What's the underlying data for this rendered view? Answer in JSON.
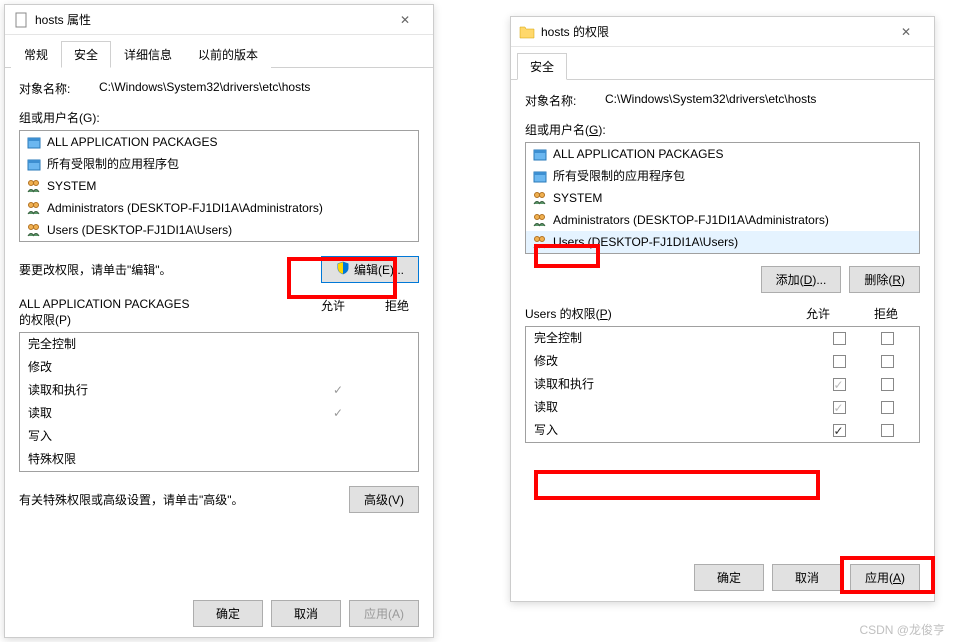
{
  "left": {
    "title": "hosts 属性",
    "tabs": [
      "常规",
      "安全",
      "详细信息",
      "以前的版本"
    ],
    "active_tab_index": 1,
    "object_label": "对象名称:",
    "object_value": "C:\\Windows\\System32\\drivers\\etc\\hosts",
    "group_label": "组或用户名(G):",
    "groups": [
      {
        "name": "ALL APPLICATION PACKAGES",
        "icon": "package"
      },
      {
        "name": "所有受限制的应用程序包",
        "icon": "package"
      },
      {
        "name": "SYSTEM",
        "icon": "users"
      },
      {
        "name": "Administrators (DESKTOP-FJ1DI1A\\Administrators)",
        "icon": "users"
      },
      {
        "name": "Users (DESKTOP-FJ1DI1A\\Users)",
        "icon": "users"
      }
    ],
    "edit_hint": "要更改权限，请单击\"编辑\"。",
    "edit_btn": "编辑(E)...",
    "perm_title_line1": "ALL APPLICATION PACKAGES",
    "perm_title_line2": "的权限(P)",
    "allow_header": "允许",
    "deny_header": "拒绝",
    "permissions": [
      {
        "name": "完全控制",
        "allow": "",
        "deny": ""
      },
      {
        "name": "修改",
        "allow": "",
        "deny": ""
      },
      {
        "name": "读取和执行",
        "allow": "✓",
        "deny": ""
      },
      {
        "name": "读取",
        "allow": "✓",
        "deny": ""
      },
      {
        "name": "写入",
        "allow": "",
        "deny": ""
      },
      {
        "name": "特殊权限",
        "allow": "",
        "deny": ""
      }
    ],
    "advanced_hint": "有关特殊权限或高级设置，请单击\"高级\"。",
    "advanced_btn": "高级(V)",
    "ok_btn": "确定",
    "cancel_btn": "取消",
    "apply_btn": "应用(A)"
  },
  "right": {
    "title": "hosts 的权限",
    "tabs": [
      "安全"
    ],
    "object_label": "对象名称:",
    "object_value": "C:\\Windows\\System32\\drivers\\etc\\hosts",
    "group_label": "组或用户名(G):",
    "groups": [
      {
        "name": "ALL APPLICATION PACKAGES",
        "icon": "package"
      },
      {
        "name": "所有受限制的应用程序包",
        "icon": "package"
      },
      {
        "name": "SYSTEM",
        "icon": "users"
      },
      {
        "name": "Administrators (DESKTOP-FJ1DI1A\\Administrators)",
        "icon": "users"
      },
      {
        "name": "Users (DESKTOP-FJ1DI1A\\Users)",
        "icon": "users",
        "selected": true
      }
    ],
    "add_btn": "添加(D)...",
    "remove_btn": "删除(R)",
    "perm_title": "Users 的权限(P)",
    "allow_header": "允许",
    "deny_header": "拒绝",
    "permissions": [
      {
        "name": "完全控制",
        "allow": false,
        "deny": false,
        "allow_gray": false
      },
      {
        "name": "修改",
        "allow": false,
        "deny": false,
        "allow_gray": false
      },
      {
        "name": "读取和执行",
        "allow": true,
        "deny": false,
        "allow_gray": true
      },
      {
        "name": "读取",
        "allow": true,
        "deny": false,
        "allow_gray": true
      },
      {
        "name": "写入",
        "allow": true,
        "deny": false,
        "allow_gray": false
      }
    ],
    "ok_btn": "确定",
    "cancel_btn": "取消",
    "apply_btn": "应用(A)"
  },
  "watermark": "CSDN @龙俊亨"
}
